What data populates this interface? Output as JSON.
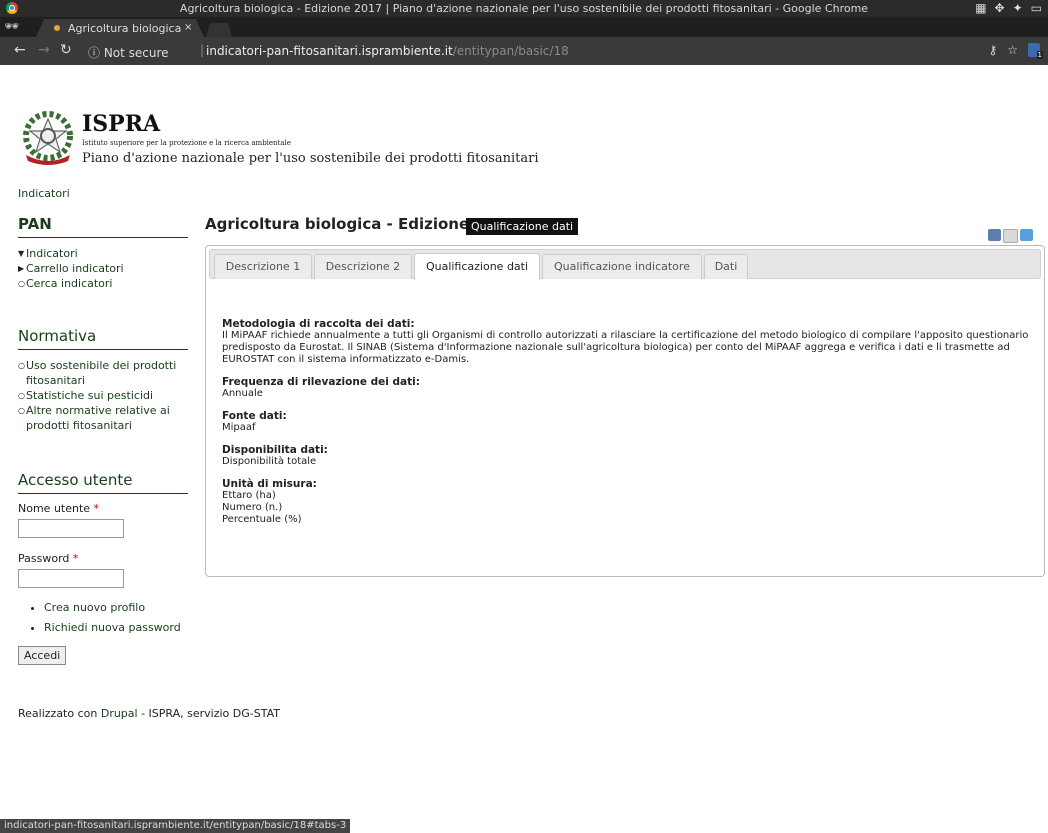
{
  "browser": {
    "window_title": "Agricoltura biologica - Edizione 2017 | Piano d'azione nazionale per l'uso sostenibile dei prodotti fitosanitari - Google Chrome",
    "tab_label": "Agricoltura biologica",
    "tab_close": "×",
    "security_label": "ⓘ Not secure",
    "separator": "|",
    "url_host": "indicatori-pan-fitosanitari.isprambiente.it",
    "url_path": "/entitypan/basic/18",
    "status_url": "indicatori-pan-fitosanitari.isprambiente.it/entitypan/basic/18#tabs-3"
  },
  "header": {
    "brand": "ISPRA",
    "subbrand": "Istituto superiore per la protezione e la ricerca ambientale",
    "site_name": "Piano d'azione nazionale per l'uso sostenibile dei prodotti fitosanitari"
  },
  "breadcrumb": "Indicatori",
  "sidebar": {
    "pan": {
      "title": "PAN",
      "items": [
        "Indicatori",
        "Carrello indicatori",
        "Cerca indicatori"
      ]
    },
    "normativa": {
      "title": "Normativa",
      "items": [
        "Uso sostenibile dei prodotti fitosanitari",
        "Statistiche sui pesticidi",
        "Altre normative relative ai prodotti fitosanitari"
      ]
    },
    "login": {
      "title": "Accesso utente",
      "username_label": "Nome utente",
      "password_label": "Password",
      "required_mark": "*",
      "links": [
        "Crea nuovo profilo",
        "Richiedi nuova password"
      ],
      "submit_label": "Accedi"
    }
  },
  "main": {
    "title": "Agricoltura biologica - Edizione 2017",
    "tabs": [
      "Descrizione 1",
      "Descrizione 2",
      "Qualificazione dati",
      "Qualificazione indicatore",
      "Dati"
    ],
    "active_tab": "Qualificazione dati",
    "tooltip": "Qualificazione dati",
    "fields": [
      {
        "label": "Metodologia di raccolta dei dati:",
        "value": "Il MiPAAF richiede annualmente a tutti gli Organismi di controllo autorizzati a rilasciare la certificazione del metodo biologico di compilare l'apposito questionario predisposto da Eurostat. Il SINAB (Sistema d'Informazione nazionale sull'agricoltura biologica) per conto del MiPAAF aggrega e verifica i dati e li trasmette ad EUROSTAT con il sistema informatizzato e-Damis."
      },
      {
        "label": "Frequenza di rilevazione dei dati:",
        "value": "Annuale"
      },
      {
        "label": "Fonte dati:",
        "value": "Mipaaf"
      },
      {
        "label": "Disponibilita dati:",
        "value": "Disponibilità totale"
      },
      {
        "label": "Unità di misura:",
        "value": "Ettaro (ha)\nNumero (n.)\nPercentuale (%)"
      }
    ]
  },
  "footer": {
    "prefix": "Realizzato con ",
    "link": "Drupal",
    "suffix": " - ISPRA, servizio DG-STAT"
  }
}
